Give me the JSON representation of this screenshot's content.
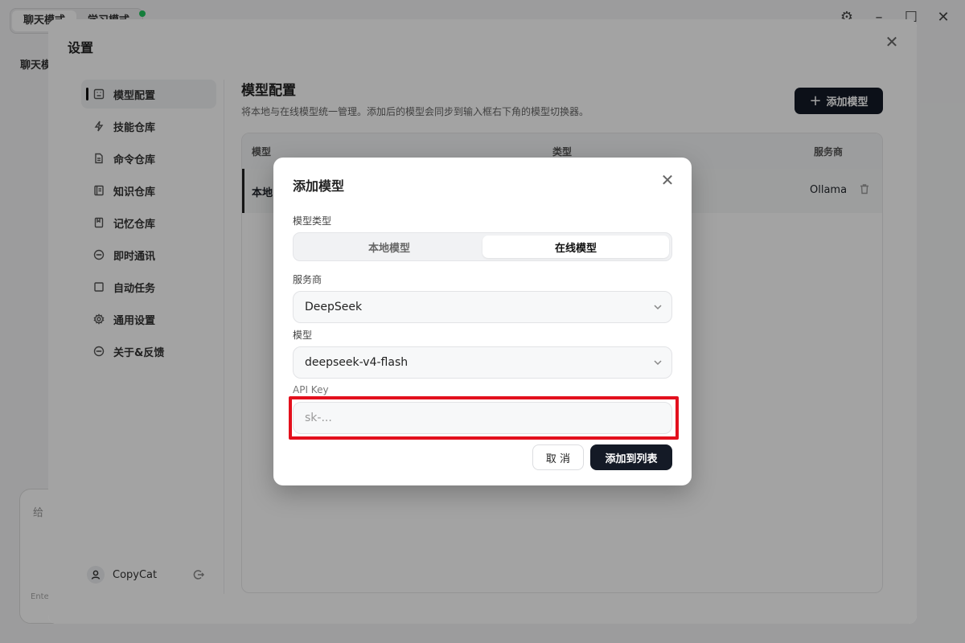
{
  "app": {
    "tabs": [
      "聊天模式",
      "学习模式"
    ],
    "sidebar_title": "聊天模",
    "chat_placeholder": "给",
    "chat_hint": "Ente"
  },
  "settings": {
    "title": "设置",
    "nav": [
      {
        "label": "模型配置",
        "icon": "model-icon",
        "active": true
      },
      {
        "label": "技能仓库",
        "icon": "bolt-icon"
      },
      {
        "label": "命令仓库",
        "icon": "file-icon"
      },
      {
        "label": "知识仓库",
        "icon": "book-icon"
      },
      {
        "label": "记忆仓库",
        "icon": "bookmark-icon"
      },
      {
        "label": "即时通讯",
        "icon": "chat-icon"
      },
      {
        "label": "自动任务",
        "icon": "square-icon"
      },
      {
        "label": "通用设置",
        "icon": "gear-icon"
      },
      {
        "label": "关于&反馈",
        "icon": "chat-icon"
      }
    ],
    "user": {
      "name": "CopyCat"
    },
    "main": {
      "title": "模型配置",
      "description": "将本地与在线模型统一管理。添加后的模型会同步到输入框右下角的模型切换器。",
      "add_button": "添加模型",
      "table": {
        "headers": [
          "模型",
          "类型",
          "服务商"
        ],
        "rows": [
          {
            "model": "本地",
            "provider": "Ollama"
          }
        ]
      }
    }
  },
  "dialog": {
    "title": "添加模型",
    "model_type_label": "模型类型",
    "segments": [
      "本地模型",
      "在线模型"
    ],
    "active_segment": "在线模型",
    "provider_label": "服务商",
    "provider_value": "DeepSeek",
    "model_label": "模型",
    "model_value": "deepseek-v4-flash",
    "api_key_label": "API Key",
    "api_key_placeholder": "sk-...",
    "api_key_value": "",
    "cancel_label": "取 消",
    "submit_label": "添加到列表",
    "highlight_color": "#e3101d"
  }
}
